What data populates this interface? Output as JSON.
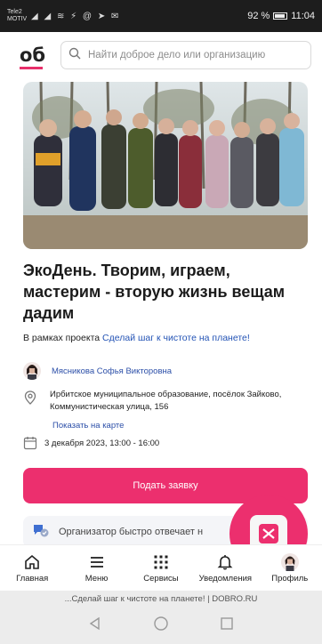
{
  "status_bar": {
    "carrier": "Tele2 MOTIV",
    "battery": "92 %",
    "time": "11:04",
    "battery_level": 0.92
  },
  "header": {
    "logo": "об",
    "search_placeholder": "Найти доброе дело или организацию"
  },
  "event": {
    "title": "ЭкоДень. Творим, играем, мастерим - вторую жизнь вещам дадим",
    "project_prefix": "В рамках проекта",
    "project_link": "Сделай шаг к чистоте на планете!",
    "organizer": "Мясникова Софья Викторовна",
    "address": "Ирбитское муниципальное образование, посёлок Зайково, Коммунистическая улица, 156",
    "map_link": "Показать на карте",
    "date": "3 декабря 2023, 13:00 - 16:00",
    "apply_label": "Подать заявку",
    "notice": "Организатор быстро отвечает н"
  },
  "nav": [
    {
      "label": "Главная",
      "icon": "home-icon"
    },
    {
      "label": "Меню",
      "icon": "menu-icon"
    },
    {
      "label": "Сервисы",
      "icon": "services-grid-icon"
    },
    {
      "label": "Уведомления",
      "icon": "bell-icon"
    },
    {
      "label": "Профиль",
      "icon": "profile-avatar"
    }
  ],
  "browser": {
    "caption": "...Сделай шаг к чистоте на планете! | DOBRO.RU"
  },
  "colors": {
    "accent": "#ec2f6e",
    "link": "#2c4fa8"
  }
}
